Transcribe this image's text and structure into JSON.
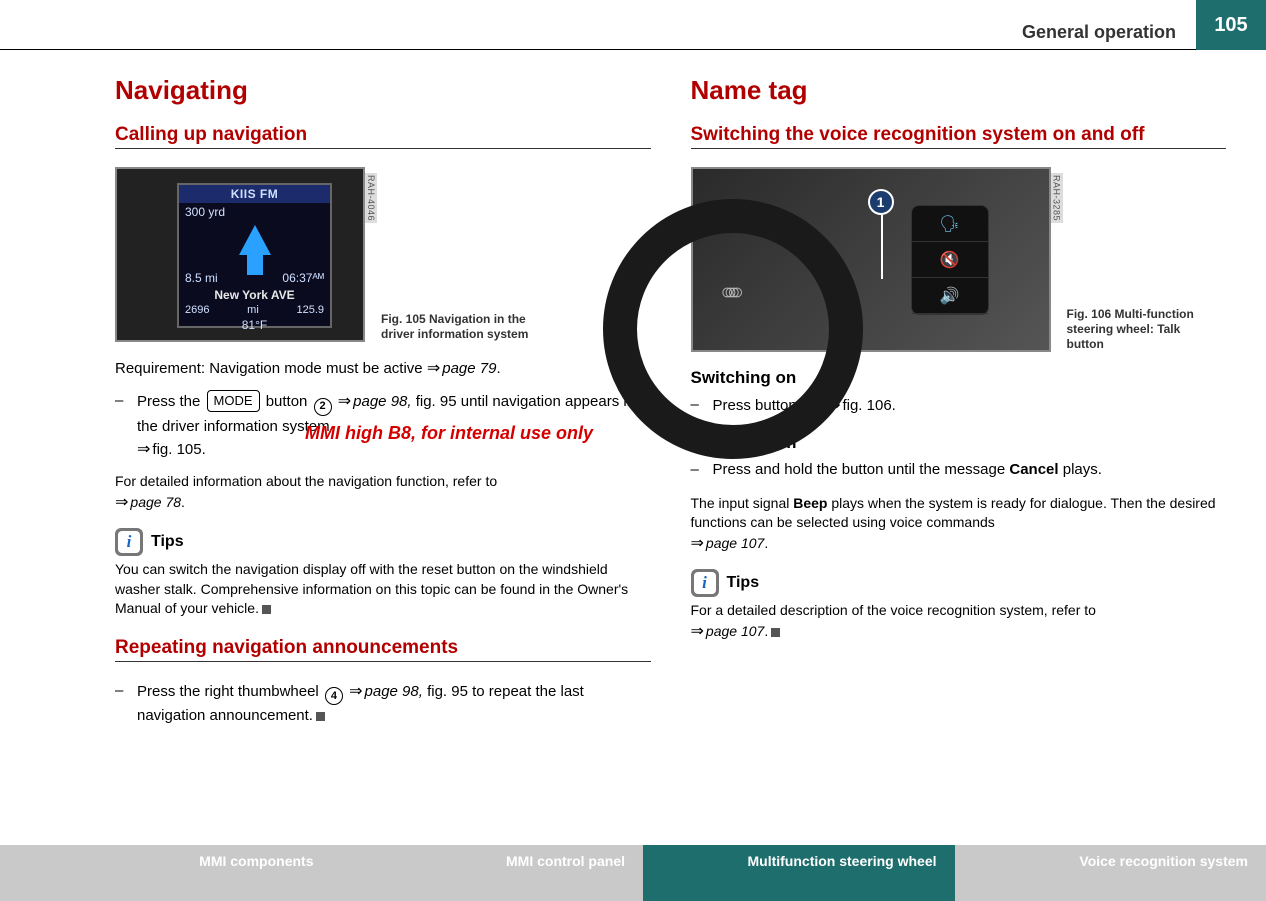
{
  "header": {
    "section": "General operation",
    "page": "105"
  },
  "watermark": "MMI high B8, for internal use only",
  "left": {
    "h1": "Navigating",
    "s1": {
      "title": "Calling up navigation",
      "fig": {
        "ref": "RAH-4046",
        "caption": "Fig. 105   Navigation in the driver information system",
        "station": "KIIS FM",
        "dist_ahead": "300 yrd",
        "total_dist": "8.5 mi",
        "eta": "06:37ᴬᴹ",
        "street": "New York AVE",
        "odo": "2696",
        "odo_unit": "mi",
        "freq": "125.9",
        "temp": "81°F"
      },
      "req_pre": "Requirement: Navigation mode must be active ",
      "req_ref": "page 79",
      "req_post": ".",
      "step1_a": "Press the ",
      "mode_label": "MODE",
      "step1_b": " button ",
      "step1_circ": "2",
      "step1_ref1": "page 98,",
      "step1_c": " fig. 95 until navigation appears in the driver information system ",
      "step1_d": "fig. 105.",
      "detail_a": "For detailed information about the navigation function, refer to ",
      "detail_ref": "page 78",
      "detail_b": ".",
      "tips_label": "Tips",
      "tips_text": "You can switch the navigation display off with the reset button on the windshield washer stalk. Comprehensive information on this topic can be found in the Owner's Manual of your vehicle."
    },
    "s2": {
      "title": "Repeating navigation announcements",
      "step_a": "Press the right thumbwheel ",
      "step_circ": "4",
      "step_ref": "page 98,",
      "step_b": " fig. 95 to repeat the last navigation announcement."
    }
  },
  "right": {
    "h1": "Name tag",
    "s1": {
      "title": "Switching the voice recognition system on and off",
      "fig": {
        "ref": "RAH-3285",
        "caption": "Fig. 106   Multi-function steering wheel: Talk button",
        "callout": "1"
      },
      "on_title": "Switching on",
      "on_step_a": "Press button ",
      "on_circ": "1",
      "on_step_b": "fig. 106.",
      "off_title": "Switching off",
      "off_step_a": "Press and hold the button until the message ",
      "off_bold": "Cancel",
      "off_step_b": " plays.",
      "para_a": "The input signal ",
      "para_bold": "Beep",
      "para_b": " plays when the system is ready for dialogue. Then the desired functions can be selected using voice commands ",
      "para_ref": "page 107",
      "para_c": ".",
      "tips_label": "Tips",
      "tips_a": "For a detailed description of the voice recognition system, refer to ",
      "tips_ref": "page 107",
      "tips_b": "."
    }
  },
  "footer": {
    "t1": "MMI components",
    "t2": "MMI control panel",
    "t3": "Multifunction steering wheel",
    "t4": "Voice recognition system"
  }
}
